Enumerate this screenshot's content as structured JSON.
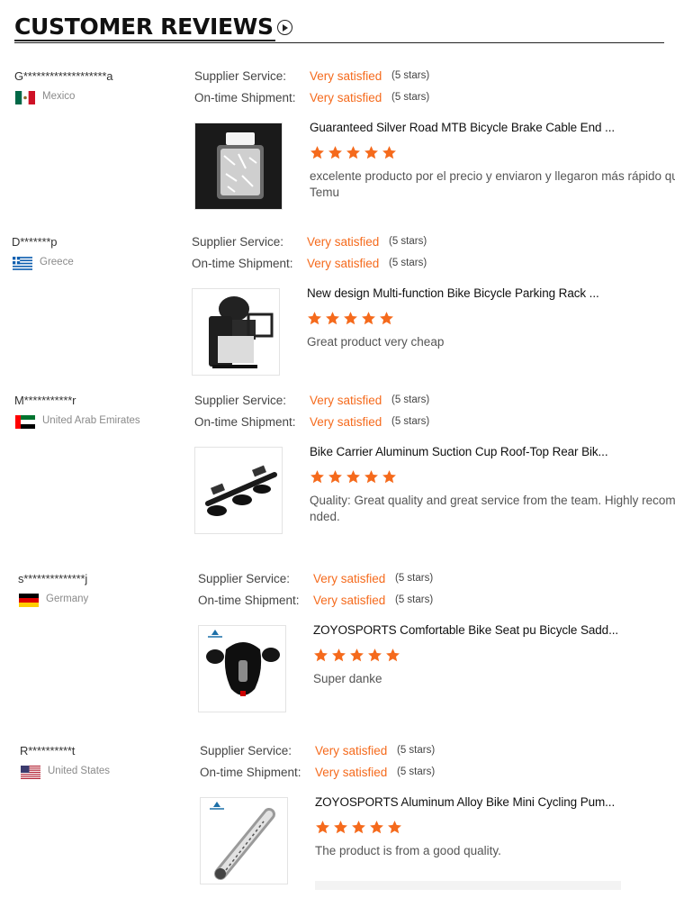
{
  "header": {
    "title": "CUSTOMER REVIEWS"
  },
  "colors": {
    "accent": "#f56a1c",
    "star": "#f56a1c",
    "muted_text": "#8a8a8a",
    "divider": "#222222"
  },
  "labels": {
    "supplier_service": "Supplier Service:",
    "on_time_shipment": "On-time Shipment:"
  },
  "reviews": [
    {
      "reviewer": "G*******************a",
      "country": "Mexico",
      "flag_icon": "mexico-flag-icon",
      "supplier_service": "Very satisfied",
      "supplier_service_stars": "(5 stars)",
      "shipment": "Very satisfied",
      "shipment_stars": "(5 stars)",
      "product_title": "Guaranteed Silver Road MTB Bicycle Brake Cable End ...",
      "product_image_icon": "brake-cable-end-caps-jar-image",
      "rating": 5,
      "comment": "excelente producto por el precio y enviaron y llegaron más rápido que Temu"
    },
    {
      "reviewer": "D*******p",
      "country": "Greece",
      "flag_icon": "greece-flag-icon",
      "supplier_service": "Very satisfied",
      "supplier_service_stars": "(5 stars)",
      "shipment": "Very satisfied",
      "shipment_stars": "(5 stars)",
      "product_title": "New design Multi-function Bike Bicycle Parking Rack ...",
      "product_image_icon": "bicycle-parking-rack-image",
      "rating": 5,
      "comment": "Great product very cheap"
    },
    {
      "reviewer": "M***********r",
      "country": "United Arab Emirates",
      "flag_icon": "uae-flag-icon",
      "supplier_service": "Very satisfied",
      "supplier_service_stars": "(5 stars)",
      "shipment": "Very satisfied",
      "shipment_stars": "(5 stars)",
      "product_title": "Bike Carrier Aluminum Suction Cup Roof-Top Rear Bik...",
      "product_image_icon": "suction-cup-bike-carrier-image",
      "rating": 5,
      "comment": "Quality:   Great quality and great service from the team. Highly recommended."
    },
    {
      "reviewer": "s**************j",
      "country": "Germany",
      "flag_icon": "germany-flag-icon",
      "supplier_service": "Very satisfied",
      "supplier_service_stars": "(5 stars)",
      "shipment": "Very satisfied",
      "shipment_stars": "(5 stars)",
      "product_title": "ZOYOSPORTS Comfortable Bike Seat pu Bicycle Sadd...",
      "product_image_icon": "bicycle-saddle-image",
      "rating": 5,
      "comment": "Super danke"
    },
    {
      "reviewer": "R**********t",
      "country": "United States",
      "flag_icon": "usa-flag-icon",
      "supplier_service": "Very satisfied",
      "supplier_service_stars": "(5 stars)",
      "shipment": "Very satisfied",
      "shipment_stars": "(5 stars)",
      "product_title": "ZOYOSPORTS Aluminum Alloy Bike Mini Cycling Pum...",
      "product_image_icon": "mini-bike-pump-image",
      "rating": 5,
      "comment": "The product is from a good quality."
    }
  ]
}
